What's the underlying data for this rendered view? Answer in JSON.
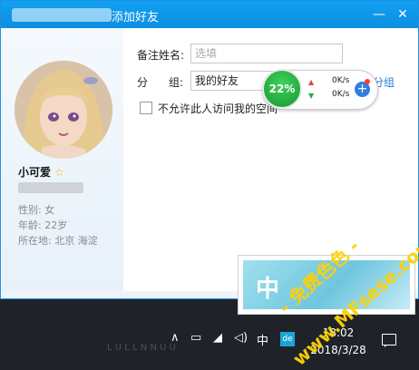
{
  "window": {
    "title": "添加好友"
  },
  "profile": {
    "nickname": "小可爱",
    "gender": "性别: 女",
    "age": "年龄: 22岁",
    "location": "所在地: 北京  海淀"
  },
  "form": {
    "remark_label": "备注姓名:",
    "remark_placeholder": "选填",
    "group_label_1": "分",
    "group_label_2": "组:",
    "group_value": "我的好友",
    "new_group_link": "分组",
    "checkbox_label": "不允许此人访问我的空间"
  },
  "speed_widget": {
    "percent": "22%",
    "up_rate": "0K/s",
    "down_rate": "0K/s"
  },
  "ime_popup": {
    "char": "中"
  },
  "watermark": {
    "line1": "- 免费色色 -",
    "line2": "www.MFsese.com"
  },
  "taskbar": {
    "time": "18:02",
    "date": "2018/3/28",
    "ime_indicator": "中",
    "dimmed_text": "L U L L N N U U"
  },
  "icons": [
    "minimize-icon",
    "close-icon",
    "star-icon",
    "chevron-up-icon",
    "battery-icon",
    "wifi-icon",
    "volume-icon",
    "notification-icon",
    "upload-arrow-icon",
    "download-arrow-icon",
    "plus-icon"
  ],
  "colors": {
    "titlebar": "#0c8ee3",
    "link": "#1d7fd8",
    "gauge": "#169a32",
    "taskbar": "#1f2329"
  }
}
